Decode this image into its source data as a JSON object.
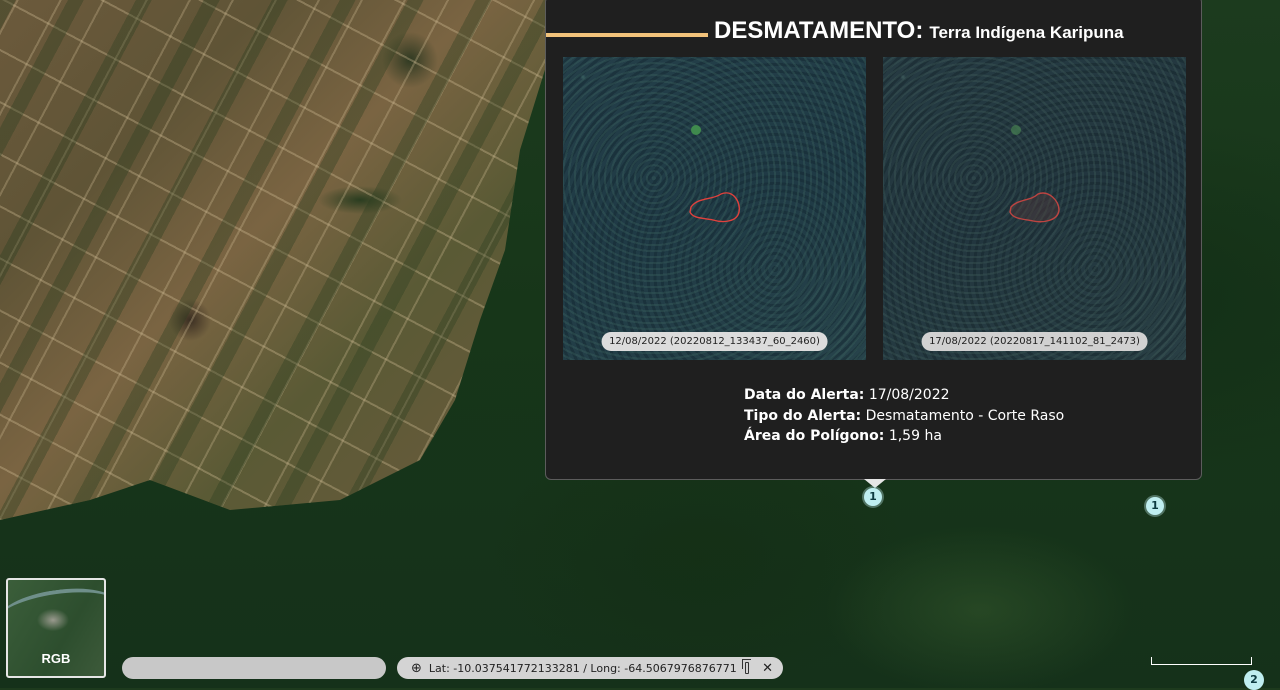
{
  "popup": {
    "title": "DESMATAMENTO:",
    "subtitle": "Terra Indígena Karipuna",
    "images": [
      {
        "label": "12/08/2022 (20220812_133437_60_2460)"
      },
      {
        "label": "17/08/2022 (20220817_141102_81_2473)"
      }
    ],
    "info": {
      "date_label": "Data do Alerta:",
      "date_value": "17/08/2022",
      "type_label": "Tipo do Alerta:",
      "type_value": "Desmatamento - Corte Raso",
      "area_label": "Área do Polígono:",
      "area_value": "1,59 ha"
    }
  },
  "markers": [
    {
      "label": "1"
    },
    {
      "label": "1"
    },
    {
      "label": "2"
    }
  ],
  "basemap": {
    "label": "RGB"
  },
  "coordinates": {
    "text": "Lat: -10.037541772133281 / Long: -64.5067976876771"
  },
  "colors": {
    "accent": "#f2c27a",
    "marker": "#bfeef0",
    "popup_bg": "#1f1f1f",
    "polygon": "#e0413d"
  },
  "icons": {
    "coords_icon": "crosshair-plus-icon",
    "copy_icon": "copy-icon",
    "close_icon": "close-icon"
  }
}
